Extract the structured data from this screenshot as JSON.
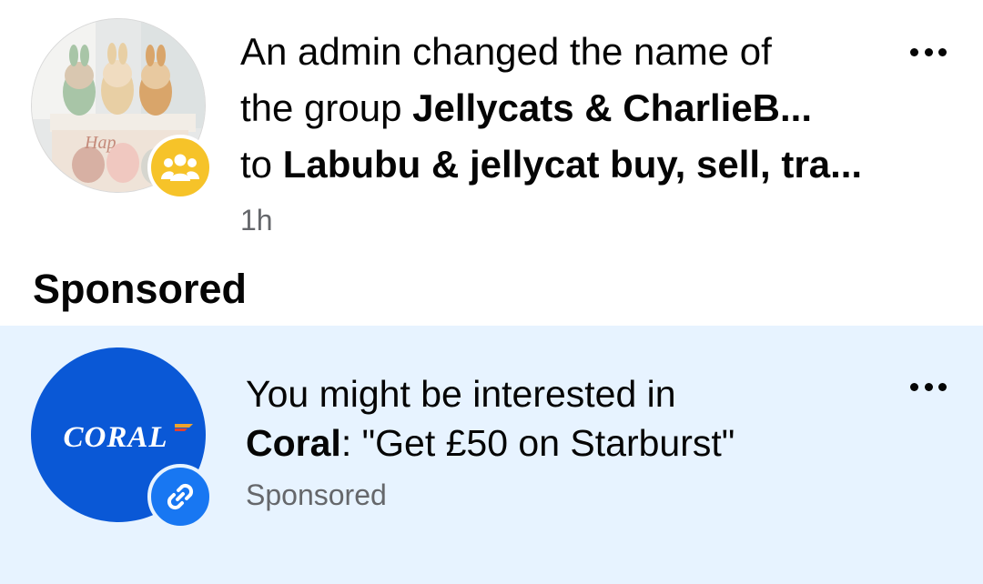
{
  "notifications": [
    {
      "line1": "An admin changed the name of",
      "line2_prefix": "the group ",
      "line2_bold": "Jellycats & CharlieB...",
      "line3_prefix": "to ",
      "line3_bold": "Labubu & jellycat buy, sell, tra...",
      "time": "1h",
      "avatar_icon": "group-photo",
      "badge_icon": "group-icon",
      "badge_color": "#f6c329",
      "photo_text": "Hap"
    },
    {
      "line1": "You might be interested in",
      "line2_bold": "Coral",
      "line2_rest": ": \"Get £50 on Starburst\"",
      "time": "Sponsored",
      "avatar_text": "CORAL",
      "avatar_color": "#0a58d6",
      "badge_icon": "link-icon",
      "badge_color": "#1877f2",
      "background": "#e7f3ff"
    }
  ],
  "section_header": "Sponsored"
}
